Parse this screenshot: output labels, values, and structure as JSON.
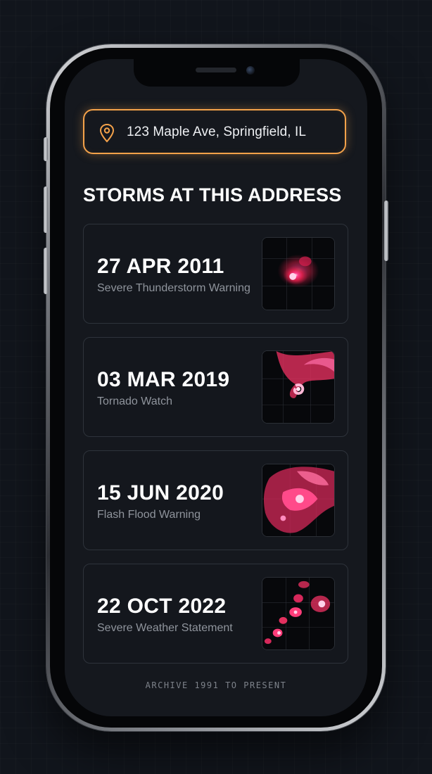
{
  "address": {
    "value": "123 Maple Ave, Springfield, IL",
    "icon": "location-pin-icon",
    "accent_color": "#f4a24a"
  },
  "heading": "STORMS AT THIS ADDRESS",
  "storms": [
    {
      "date": "27 APR 2011",
      "type": "Severe Thunderstorm Warning"
    },
    {
      "date": "03 MAR 2019",
      "type": "Tornado Watch"
    },
    {
      "date": "15 JUN 2020",
      "type": "Flash Flood Warning"
    },
    {
      "date": "22 OCT 2022",
      "type": "Severe Weather Statement"
    }
  ],
  "footer": "ARCHIVE 1991 TO PRESENT"
}
